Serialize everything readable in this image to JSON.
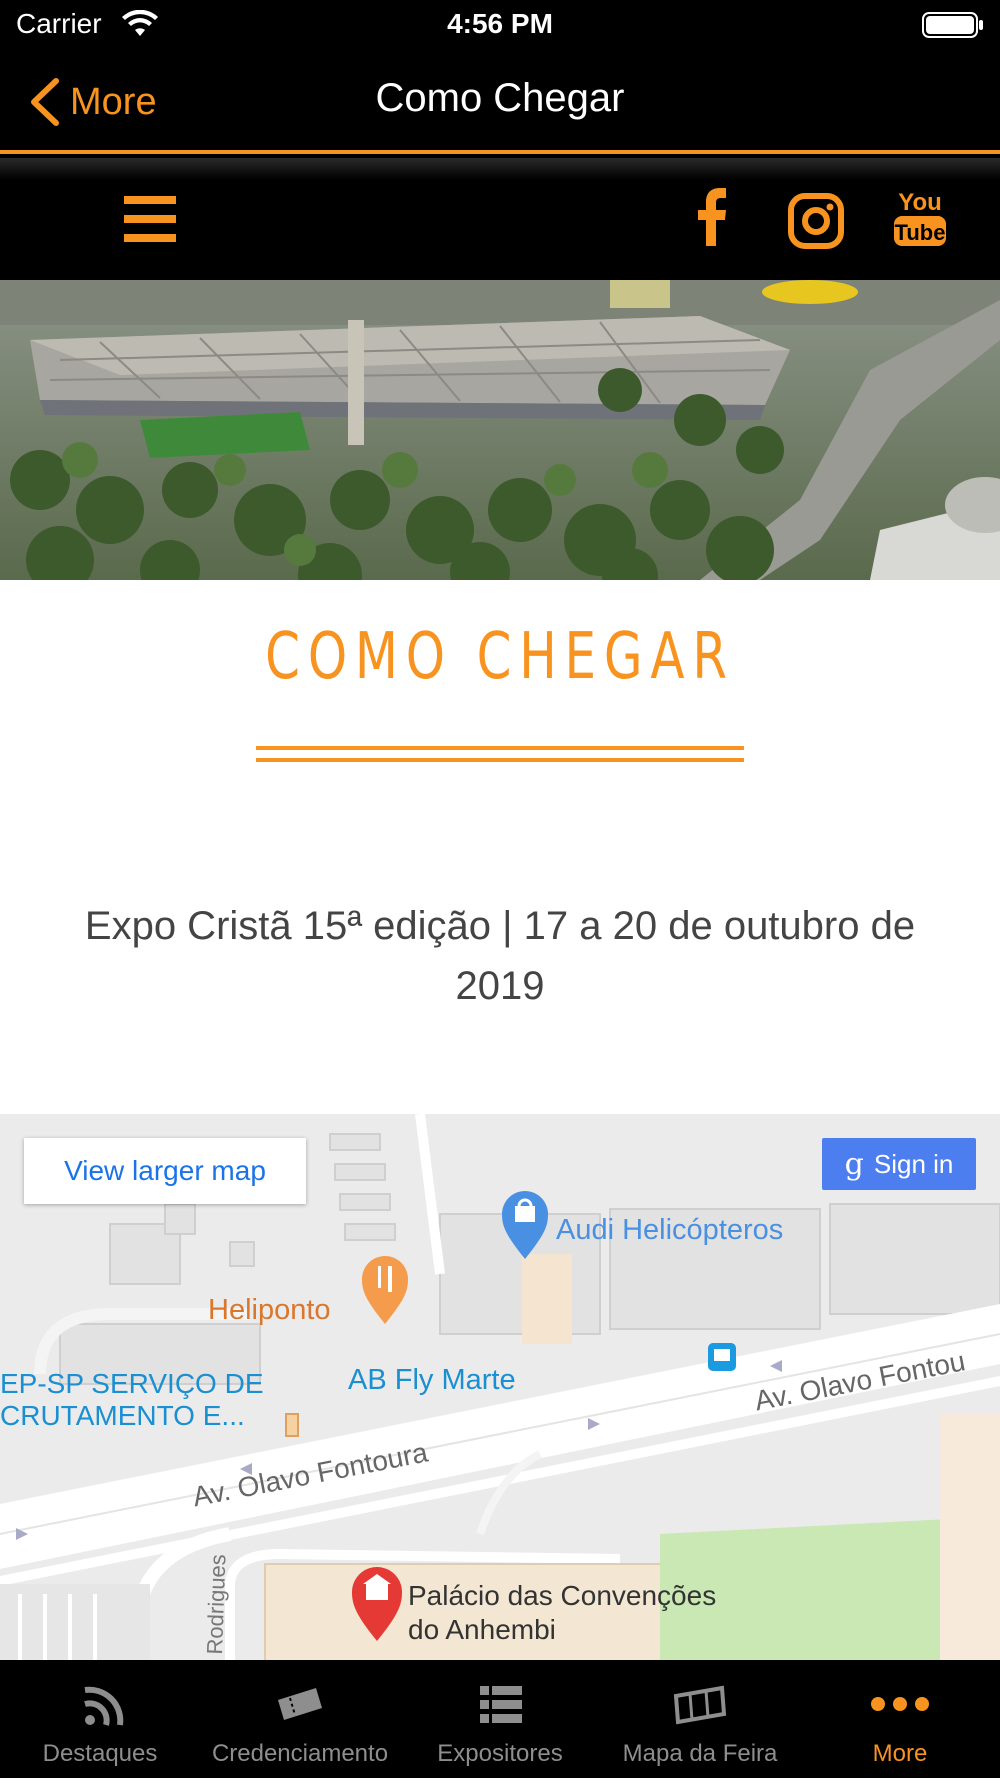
{
  "status_bar": {
    "carrier": "Carrier",
    "time": "4:56 PM"
  },
  "nav_bar": {
    "back_label": "More",
    "title": "Como Chegar"
  },
  "site_header": {
    "icons": [
      "menu-icon",
      "facebook-icon",
      "instagram-icon",
      "youtube-icon"
    ],
    "youtube_text_top": "You",
    "youtube_text_bottom": "Tube"
  },
  "content": {
    "section_title": "COMO CHEGAR",
    "event_text": "Expo Cristã 15ª edição | 17 a 20 de outubro de 2019"
  },
  "map": {
    "larger_map_label": "View larger map",
    "sign_in_label": "Sign in",
    "places": {
      "audi": "Audi Helicópteros",
      "heliponto": "Heliponto",
      "ab_fly": "AB Fly Marte",
      "cep_line1": "EP-SP SERVIÇO DE",
      "cep_line2": "CRUTAMENTO E...",
      "palacio_line1": "Palácio das Convenções",
      "palacio_line2": "do Anhembi"
    },
    "streets": {
      "olavo_main": "Av. Olavo Fontoura",
      "olavo_right": "Av. Olavo Fontou",
      "rodrigues": "Rodrigues"
    }
  },
  "tab_bar": {
    "tabs": [
      {
        "label": "Destaques",
        "icon": "rss-icon",
        "active": false
      },
      {
        "label": "Credenciamento",
        "icon": "ticket-icon",
        "active": false
      },
      {
        "label": "Expositores",
        "icon": "list-icon",
        "active": false
      },
      {
        "label": "Mapa da Feira",
        "icon": "map-icon",
        "active": false
      },
      {
        "label": "More",
        "icon": "more-icon",
        "active": true
      }
    ]
  },
  "colors": {
    "accent": "#f7931e",
    "background": "#000000",
    "tab_inactive": "#8e8e8e",
    "map_link": "#1a73e8",
    "sign_in": "#4d7ef0"
  }
}
